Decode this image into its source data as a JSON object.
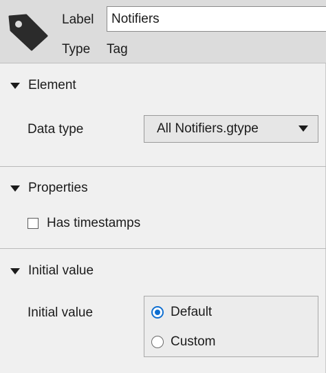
{
  "header": {
    "icon": "tag-icon",
    "label_caption": "Label",
    "label_value": "Notifiers",
    "type_caption": "Type",
    "type_value": "Tag"
  },
  "sections": {
    "element": {
      "title": "Element",
      "data_type_label": "Data type",
      "data_type_selected": "All Notifiers.gtype"
    },
    "properties": {
      "title": "Properties",
      "has_timestamps_label": "Has timestamps",
      "has_timestamps_checked": false
    },
    "initial_value": {
      "title": "Initial value",
      "field_label": "Initial value",
      "options": [
        "Default",
        "Custom"
      ],
      "selected": "Default"
    }
  },
  "colors": {
    "header_bg": "#dcdcdc",
    "panel_bg": "#f0f0f0",
    "accent": "#0f6fd1"
  }
}
